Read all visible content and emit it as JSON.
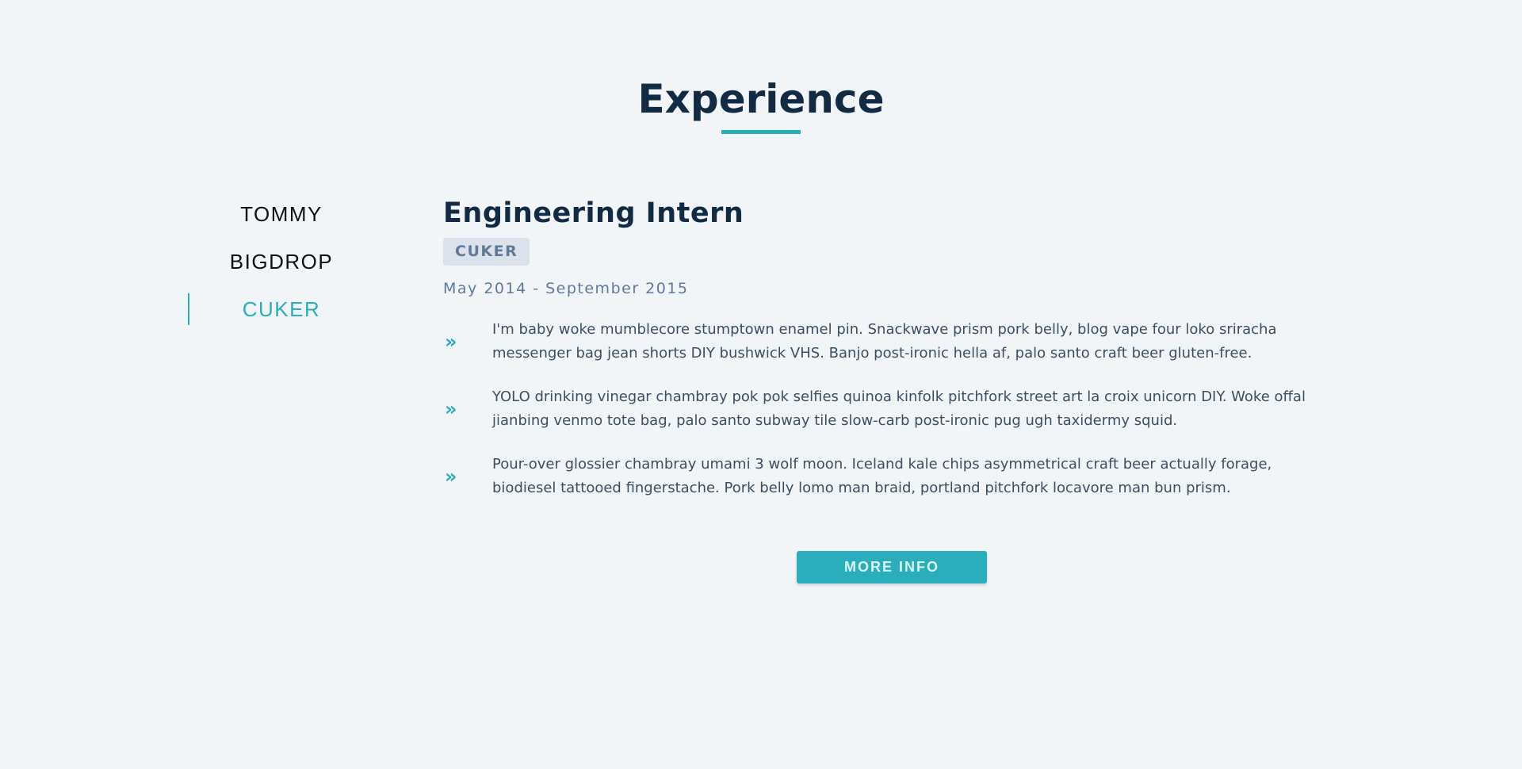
{
  "section": {
    "title": "Experience",
    "accent_color": "#2aaebb"
  },
  "nav": {
    "items": [
      {
        "label": "TOMMY",
        "active": false
      },
      {
        "label": "BIGDROP",
        "active": false
      },
      {
        "label": "CUKER",
        "active": true
      }
    ]
  },
  "job": {
    "title": "Engineering Intern",
    "company": "CUKER",
    "dates": "May 2014 - September 2015",
    "bullet_icon": "double-chevron-right-icon",
    "duties": [
      "I'm baby woke mumblecore stumptown enamel pin. Snackwave prism pork belly, blog vape four loko sriracha messenger bag jean shorts DIY bushwick VHS. Banjo post-ironic hella af, palo santo craft beer gluten-free.",
      "YOLO drinking vinegar chambray pok pok selfies quinoa kinfolk pitchfork street art la croix unicorn DIY. Woke offal jianbing venmo tote bag, palo santo subway tile slow-carb post-ironic pug ugh taxidermy squid.",
      "Pour-over glossier chambray umami 3 wolf moon. Iceland kale chips asymmetrical craft beer actually forage, biodiesel tattooed fingerstache. Pork belly lomo man braid, portland pitchfork locavore man bun prism."
    ]
  },
  "button": {
    "label": "MORE INFO"
  }
}
